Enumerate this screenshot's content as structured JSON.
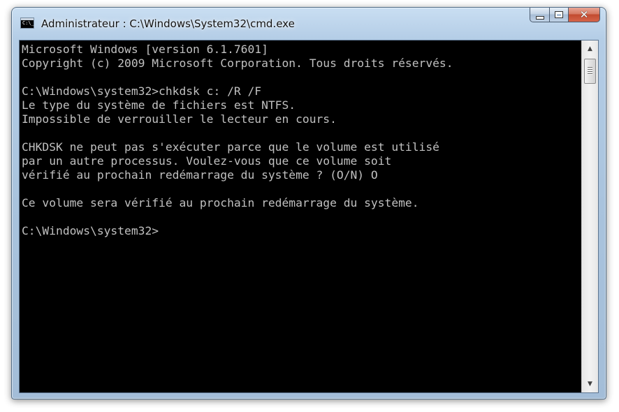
{
  "window": {
    "title": "Administrateur : C:\\Windows\\System32\\cmd.exe",
    "icon": "cmd-icon",
    "icon_glyph": "C:\\_"
  },
  "caption_buttons": {
    "minimize_icon": "minimize-icon",
    "maximize_icon": "maximize-icon",
    "close_icon": "close-icon",
    "close_glyph": "✕"
  },
  "colors": {
    "console_background": "#000000",
    "console_text": "#c0c0c0",
    "close_button": "#c24a2f"
  },
  "console": {
    "lines": [
      "Microsoft Windows [version 6.1.7601]",
      "Copyright (c) 2009 Microsoft Corporation. Tous droits réservés.",
      "",
      "C:\\Windows\\system32>chkdsk c: /R /F",
      "Le type du système de fichiers est NTFS.",
      "Impossible de verrouiller le lecteur en cours.",
      "",
      "CHKDSK ne peut pas s'exécuter parce que le volume est utilisé",
      "par un autre processus. Voulez-vous que ce volume soit",
      "vérifié au prochain redémarrage du système ? (O/N) O",
      "",
      "Ce volume sera vérifié au prochain redémarrage du système.",
      "",
      "C:\\Windows\\system32>"
    ]
  },
  "scrollbar": {
    "up_arrow": "▲",
    "down_arrow": "▼"
  }
}
